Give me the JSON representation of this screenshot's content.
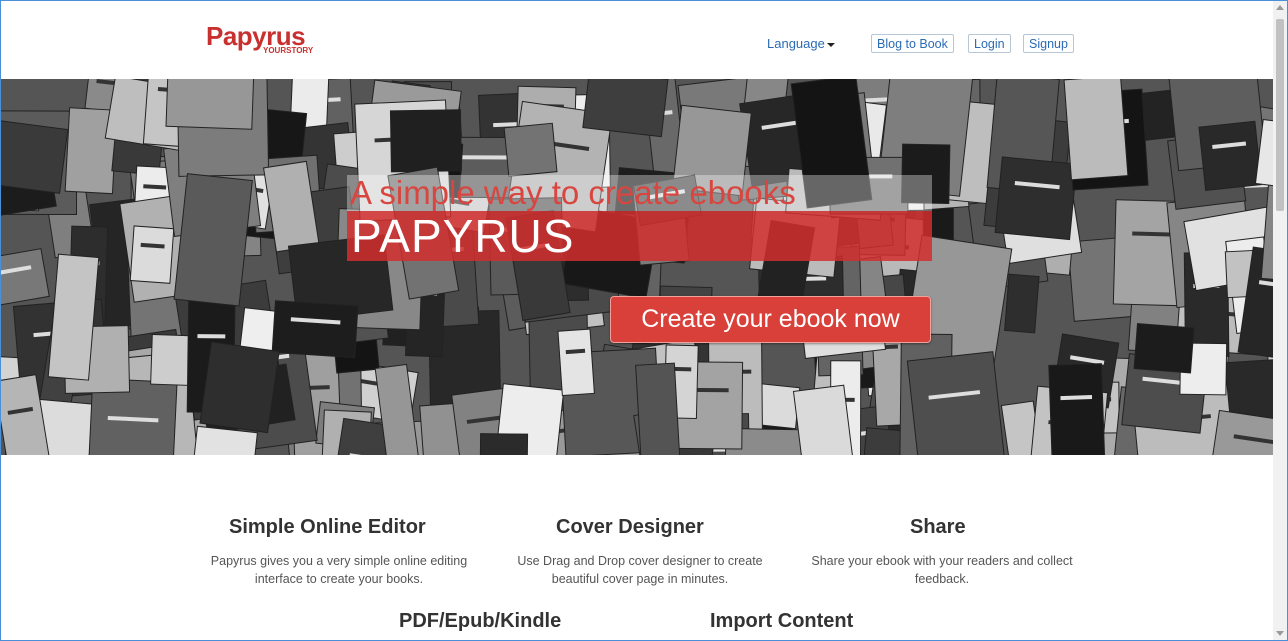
{
  "header": {
    "logo_text": "Papyrus",
    "logo_subtext": "YOURSTORY",
    "language_label": "Language",
    "nav_buttons": [
      "Blog to Book",
      "Login",
      "Signup"
    ]
  },
  "hero": {
    "tagline": "A simple way to create ebooks",
    "brand": "PAPYRUS",
    "cta_label": "Create your ebook now"
  },
  "features": [
    {
      "title": "Simple Online Editor",
      "desc": "Papyrus gives you a very simple online editing interface to create your books."
    },
    {
      "title": "Cover Designer",
      "desc": "Use Drag and Drop cover designer to create beautiful cover page in minutes."
    },
    {
      "title": "Share",
      "desc": "Share your ebook with your readers and collect feedback."
    },
    {
      "title": "PDF/Epub/Kindle",
      "desc": ""
    },
    {
      "title": "Import Content",
      "desc": ""
    }
  ],
  "colors": {
    "brand_red": "#c8312f",
    "link_blue": "#2a6bb5",
    "cta_red": "#d9403a"
  }
}
